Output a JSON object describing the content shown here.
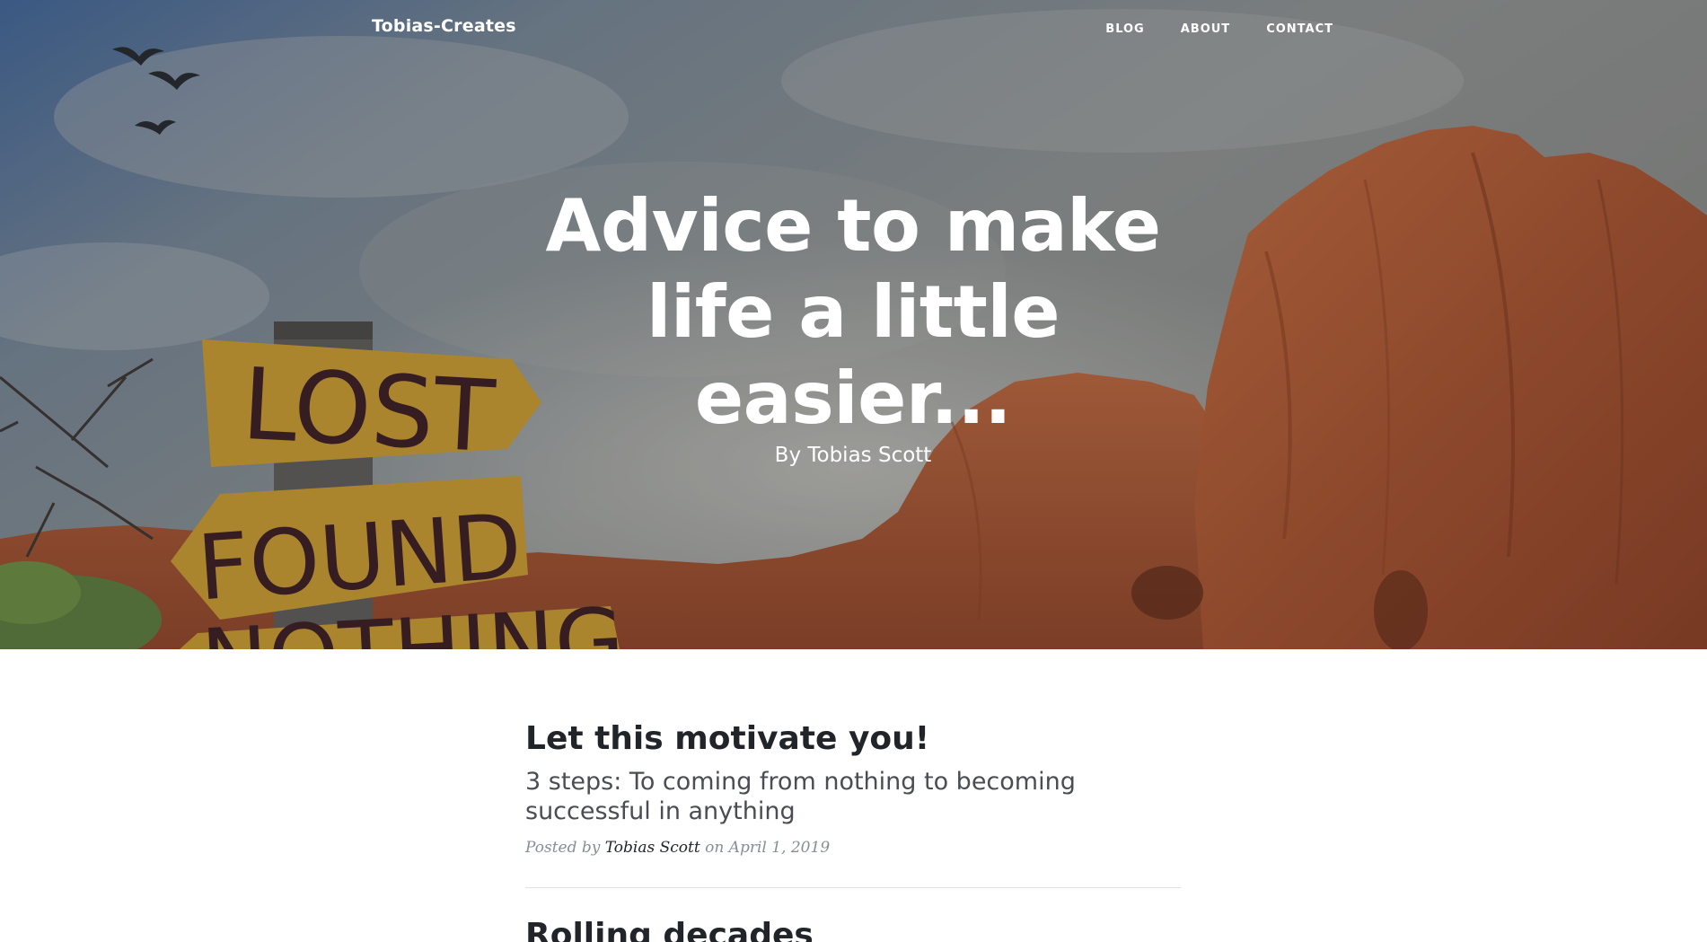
{
  "nav": {
    "brand": "Tobias-Creates",
    "links": [
      "BLOG",
      "ABOUT",
      "CONTACT"
    ]
  },
  "hero": {
    "title_lines": [
      "Advice to make",
      "life a little",
      "easier..."
    ],
    "subtitle": "By Tobias Scott",
    "sign_words": [
      "LOST",
      "FOUND",
      "NOTHING"
    ]
  },
  "posts": [
    {
      "title": "Let this motivate you!",
      "subtitle": "3 steps: To coming from nothing to becoming successful in anything",
      "meta_prefix": "Posted by",
      "author": "Tobias Scott",
      "meta_on": "on April 1, 2019"
    },
    {
      "title": "Rolling decades"
    }
  ],
  "colors": {
    "text_dark": "#212529",
    "meta_gray": "#868e96",
    "rock": "#b35a34",
    "sign": "#d2a33b"
  }
}
